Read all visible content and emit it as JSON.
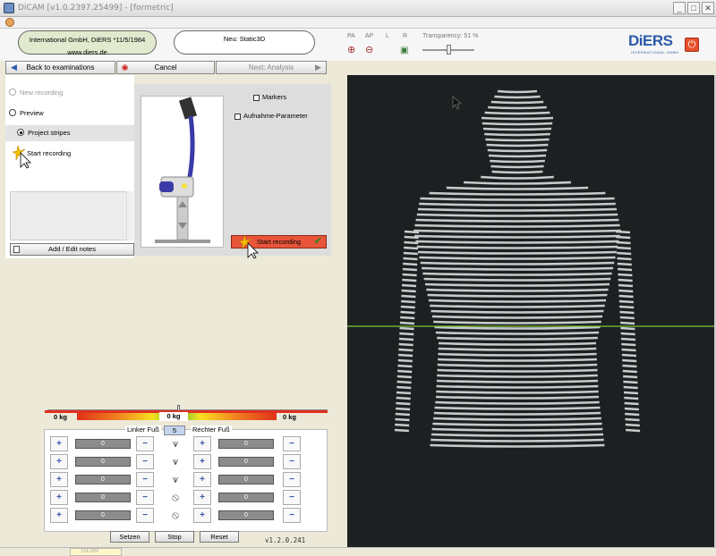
{
  "window": {
    "title": "DiCAM [v1.0.2397.25499] - [formetric]",
    "controls": [
      "_",
      "□",
      "✕"
    ]
  },
  "header": {
    "patient_line1": "International GmbH, DiERS *11/5/1984",
    "patient_line2": "www.diers.de",
    "mode_label": "Neu: Static3D",
    "views": [
      "PA",
      "AP",
      "L",
      "R"
    ],
    "transparency_label": "Transparency: 51 %",
    "transparency_percent": 51,
    "logo_text": "DiERS",
    "logo_sub": "INTERNATIONAL GMBH"
  },
  "nav": {
    "back_label": "Back to examinations",
    "cancel_label": "Cancel",
    "next_label": "Next: Analysis"
  },
  "steps": [
    {
      "label": "New recording",
      "state": "disabled"
    },
    {
      "label": "Preview",
      "state": "unselected"
    },
    {
      "label": "Project stripes",
      "state": "selected"
    },
    {
      "label": "Start recording",
      "state": "active"
    }
  ],
  "notes": {
    "button_label": "Add / Edit notes"
  },
  "settings": {
    "markers_label": "Markers",
    "params_label": "Aufnahme-Parameter",
    "start_button_label": "Start recording"
  },
  "gauge": {
    "left_value": "0 kg",
    "center_value": "0 kg",
    "right_value": "0 kg",
    "balance_fraction": 0.5
  },
  "feet": {
    "left_header": "Linker Fuß",
    "right_header": "Rechter Fuß",
    "number_value": "5",
    "left_values": [
      "0",
      "0",
      "0",
      "0",
      "0"
    ],
    "right_values": [
      "0",
      "0",
      "0",
      "0",
      "0"
    ],
    "plus_symbol": "+",
    "minus_symbol": "−",
    "set_label": "Setzen",
    "stop_label": "Stop",
    "reset_label": "Reset",
    "version": "v1.2.0.241"
  },
  "statusbar": {
    "task_label": "DiCAM"
  },
  "colors": {
    "accent_blue": "#2a5aa8",
    "record_red": "#e8553a",
    "patient_pill": "#e1eace",
    "guide_line": "#7fc23a"
  }
}
